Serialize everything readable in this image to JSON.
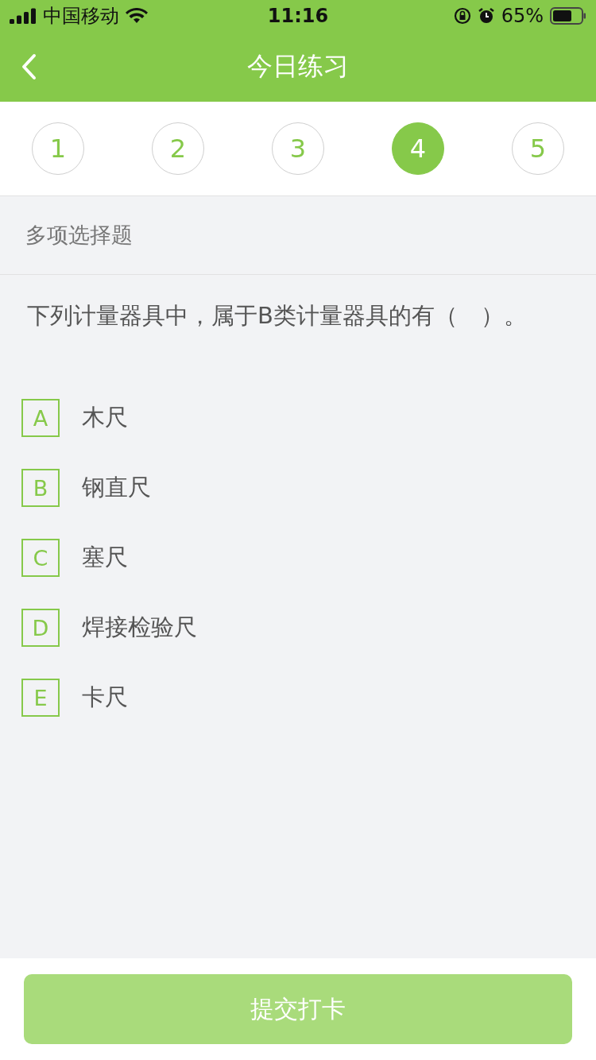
{
  "status_bar": {
    "carrier": "中国移动",
    "time": "11:16",
    "battery": "65%"
  },
  "nav": {
    "title": "今日练习"
  },
  "steps": [
    {
      "label": "1",
      "selected": false
    },
    {
      "label": "2",
      "selected": false
    },
    {
      "label": "3",
      "selected": false
    },
    {
      "label": "4",
      "selected": true
    },
    {
      "label": "5",
      "selected": false
    }
  ],
  "question": {
    "type_label": "多项选择题",
    "text": "下列计量器具中，属于B类计量器具的有（　）。",
    "options": [
      {
        "letter": "A",
        "text": "木尺",
        "selected": false
      },
      {
        "letter": "B",
        "text": "钢直尺",
        "selected": false
      },
      {
        "letter": "C",
        "text": "塞尺",
        "selected": false
      },
      {
        "letter": "D",
        "text": "焊接检验尺",
        "selected": false
      },
      {
        "letter": "E",
        "text": "卡尺",
        "selected": false
      }
    ]
  },
  "submit": {
    "label": "提交打卡",
    "disabled": true
  }
}
